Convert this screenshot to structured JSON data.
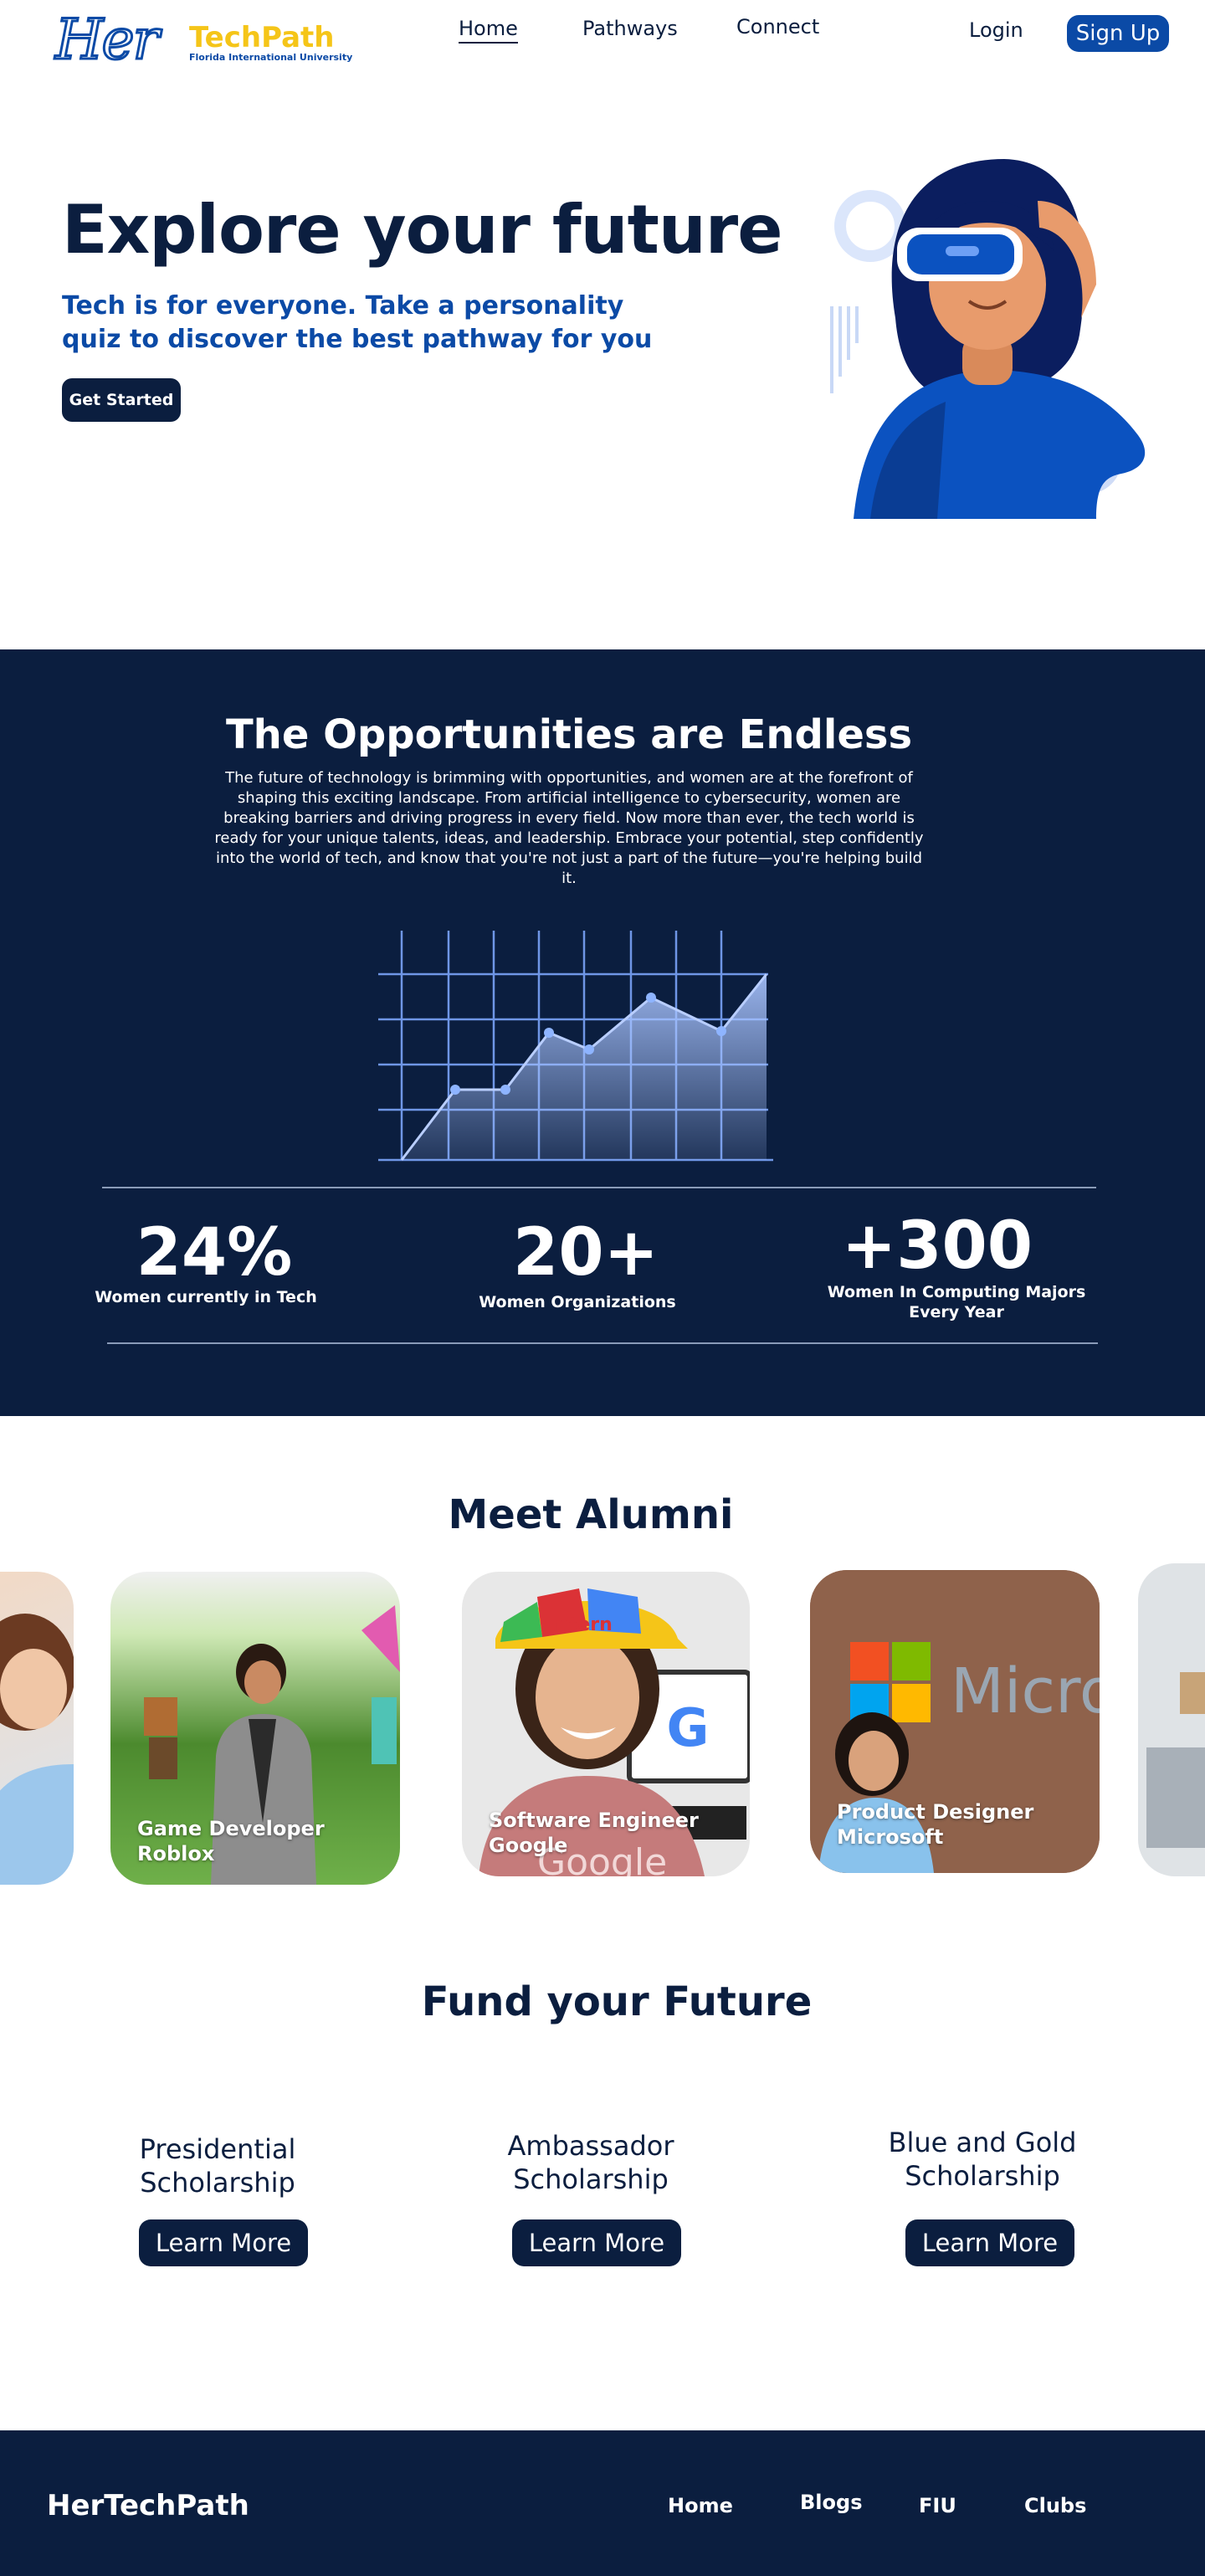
{
  "brand": {
    "logo_script": "Her",
    "logo_name": "TechPath",
    "logo_sub": "Florida International University"
  },
  "nav": {
    "home": "Home",
    "pathways": "Pathways",
    "connect": "Connect",
    "login": "Login",
    "signup": "Sign Up"
  },
  "hero": {
    "title": "Explore your future",
    "subtitle": "Tech is for everyone. Take a personality quiz to discover the best pathway for you",
    "cta": "Get Started"
  },
  "opportunities": {
    "title": "The Opportunities are Endless",
    "text": "The future of technology is brimming with opportunities, and women are at the forefront of shaping this exciting landscape. From artificial intelligence to cybersecurity, women are breaking barriers and driving progress in every field. Now more than ever, the tech world is ready for your unique talents, ideas, and leadership. Embrace your potential, step confidently into the world of tech, and know that you're not just a part of the future—you're helping build it.",
    "stats": [
      {
        "value": "24%",
        "label": "Women currently in Tech"
      },
      {
        "value": "20+",
        "label": "Women Organizations"
      },
      {
        "value": "+300",
        "label": "Women In Computing Majors Every Year"
      }
    ]
  },
  "alumni": {
    "title": "Meet Alumni",
    "cards": [
      {
        "role": "Game Developer",
        "company": "Roblox"
      },
      {
        "role": "Software Engineer",
        "company": "Google"
      },
      {
        "role": "Product Designer",
        "company": "Microsoft"
      }
    ],
    "photo_text": {
      "intern_hat": "Intern",
      "google_g": "G",
      "google_shirt": "Google",
      "microsoft_sign": "Micro"
    }
  },
  "fund": {
    "title": "Fund your Future",
    "scholarships": [
      {
        "line1": "Presidential",
        "line2": "Scholarship",
        "cta": "Learn More"
      },
      {
        "line1": "Ambassador",
        "line2": "Scholarship",
        "cta": "Learn More"
      },
      {
        "line1": "Blue and Gold",
        "line2": "Scholarship",
        "cta": "Learn More"
      }
    ]
  },
  "footer": {
    "brand": "HerTechPath",
    "links": [
      "Home",
      "Blogs",
      "FIU",
      "Clubs"
    ]
  },
  "colors": {
    "navy": "#0b1e3f",
    "brand_blue": "#0b4aa6",
    "gold": "#f5c518",
    "light_blue": "#8eb4ff"
  }
}
